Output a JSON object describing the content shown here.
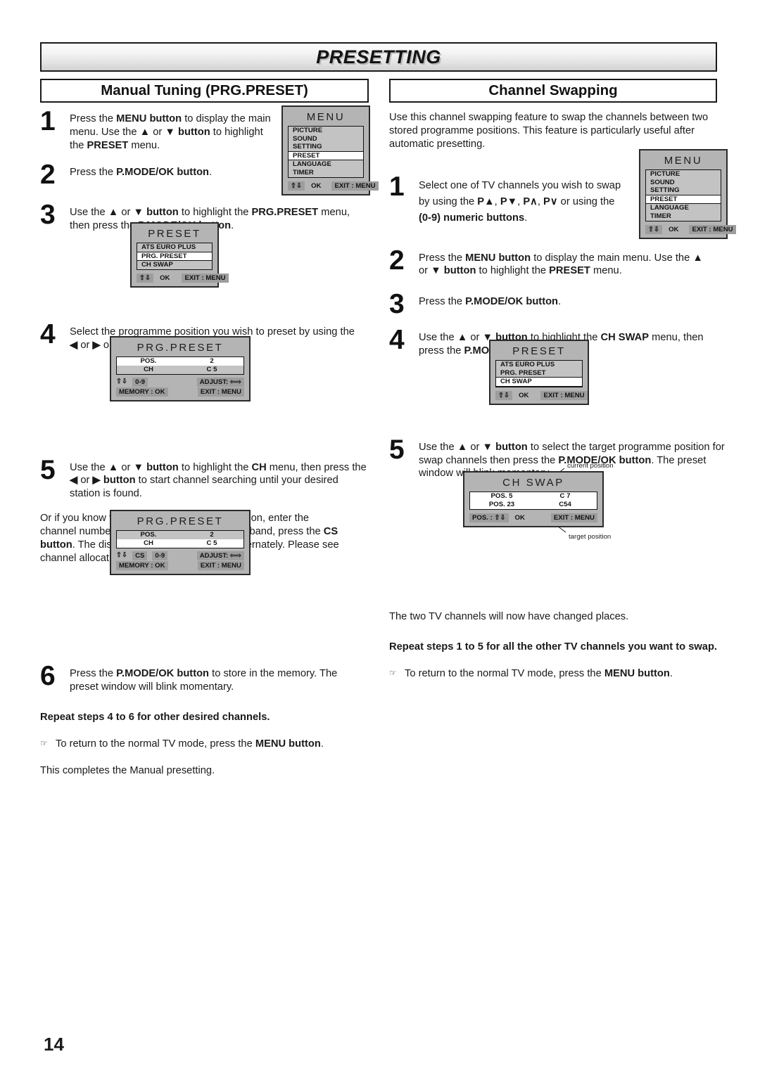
{
  "page": {
    "title": "PRESETTING",
    "number": "14"
  },
  "left": {
    "header": "Manual Tuning (PRG.PRESET)",
    "steps": {
      "s1": {
        "num": "1",
        "html": "Press the <b>MENU button</b> to display the main menu. Use the <b>&#9650;</b> or <b>&#9660; button</b> to highlight the <b>PRESET</b> menu."
      },
      "s2": {
        "num": "2",
        "html": "Press the <b>P.MODE/OK button</b>."
      },
      "s3": {
        "num": "3",
        "html": "Use the <b>&#9650;</b> or <b>&#9660; button</b> to highlight the <b>PRG.PRESET</b> menu, then press the <b>P.MODE/OK button</b>."
      },
      "s4": {
        "num": "4",
        "html": "Select the programme position you wish to preset by using the <b>&#9664;</b> or <b>&#9654;</b> or <b>0-9 numeric buttons</b>."
      },
      "s5": {
        "num": "5",
        "html": "Use the <b>&#9650;</b> or <b>&#9660; button</b> to highlight the <b>CH</b> menu, then press the <b>&#9664;</b> or <b>&#9654; button</b> to start channel searching until your desired station is found."
      },
      "s6": {
        "num": "6",
        "html": "Press the <b>P.MODE/OK button</b> to store in the memory.  The preset window will blink momentary."
      }
    },
    "paragraphs": {
      "band_note": "Or if you know the channel number of the station, enter the channel number directly. To switch to another band, press the <b>CS button</b>. The display changes &ldquo;C--&rdquo; to &ldquo;H--&rdquo; alternately. Please see channel allocation table on page 19.",
      "repeat": "Repeat steps 4 to 6 for other desired channels.",
      "return_note": "To return to the normal TV mode, press the <b>MENU button</b>.",
      "completes": "This completes the Manual presetting."
    }
  },
  "right": {
    "header": "Channel Swapping",
    "intro": "Use this channel swapping feature to swap the channels between two stored programme positions. This feature is particularly useful after automatic presetting.",
    "steps": {
      "s1": {
        "num": "1",
        "html": "Select one of TV channels you wish to swap by using the <b>P&#9650;</b>, <b>P&#9660;</b>, <b>P&#8743;</b>, <b>P&#8744;</b> or using the <b>(0-9) numeric buttons</b>."
      },
      "s2": {
        "num": "2",
        "html": "Press the <b>MENU button</b> to display the main menu. Use the <b>&#9650;</b> or <b>&#9660; button</b> to highlight the <b>PRESET</b> menu."
      },
      "s3": {
        "num": "3",
        "html": "Press the <b>P.MODE/OK button</b>."
      },
      "s4": {
        "num": "4",
        "html": "Use the <b>&#9650;</b> or <b>&#9660; button</b> to highlight the <b>CH SWAP</b> menu, then press the <b>P.MODE/OK button</b>."
      },
      "s5": {
        "num": "5",
        "html": "Use the <b>&#9650;</b> or <b>&#9660; button</b> to select the target programme position for swap channels then press the <b>P.MODE/OK button</b>. The preset window will blink momentary."
      }
    },
    "paragraphs": {
      "changed": "The two TV channels will now have changed places.",
      "repeat": "Repeat steps 1 to 5 for all the other TV channels you want to swap.",
      "return_note": "To return to the normal TV mode, press the <b>MENU button</b>."
    },
    "annotations": {
      "current_position": "current position",
      "target_position": "target position"
    }
  },
  "osd": {
    "menu_left": {
      "title": "MENU",
      "items": [
        "PICTURE",
        "SOUND",
        "SETTING",
        "PRESET",
        "LANGUAGE",
        "TIMER"
      ],
      "selected": "PRESET",
      "foot_ok": "OK",
      "foot_arrows": "⇧⇩",
      "foot_exit": "EXIT : MENU"
    },
    "menu_right": {
      "title": "MENU",
      "items": [
        "PICTURE",
        "SOUND",
        "SETTING",
        "PRESET",
        "LANGUAGE",
        "TIMER"
      ],
      "selected": "PRESET",
      "foot_ok": "OK",
      "foot_arrows": "⇧⇩",
      "foot_exit": "EXIT : MENU"
    },
    "preset_left": {
      "title": "PRESET",
      "items": [
        "ATS EURO PLUS",
        "PRG. PRESET",
        "CH SWAP"
      ],
      "selected": "PRG. PRESET",
      "foot_ok": "OK",
      "foot_arrows": "⇧⇩",
      "foot_exit": "EXIT : MENU"
    },
    "preset_right": {
      "title": "PRESET",
      "items": [
        "ATS EURO PLUS",
        "PRG. PRESET",
        "CH SWAP"
      ],
      "selected": "CH SWAP",
      "foot_ok": "OK",
      "foot_arrows": "⇧⇩",
      "foot_exit": "EXIT : MENU"
    },
    "prg_preset_1": {
      "title": "PRG.PRESET",
      "rows": [
        {
          "label": "POS.",
          "value": "2",
          "highlight": "white"
        },
        {
          "label": "CH",
          "value": "C 5",
          "highlight": "gray"
        }
      ],
      "foot_left_line1": "0-9",
      "foot_left_arrows": "⇧⇩",
      "foot_left_line2": "MEMORY : OK",
      "foot_right_line1": "ADJUST: ⇦⇨",
      "foot_right_line2": "EXIT : MENU"
    },
    "prg_preset_2": {
      "title": "PRG.PRESET",
      "rows": [
        {
          "label": "POS.",
          "value": "2",
          "highlight": "gray"
        },
        {
          "label": "CH",
          "value": "C 5",
          "highlight": "white"
        }
      ],
      "foot_left_arrows": "⇧⇩",
      "foot_left_cs": "CS",
      "foot_left_line1": "0-9",
      "foot_left_line2": "MEMORY : OK",
      "foot_right_line1": "ADJUST: ⇦⇨",
      "foot_right_line2": "EXIT : MENU"
    },
    "ch_swap": {
      "title": "CH  SWAP",
      "rows": [
        {
          "label": "POS. 5",
          "value": "C 7"
        },
        {
          "label": "POS. 23",
          "value": "C54"
        }
      ],
      "foot_pos": "POS. : ⇧⇩",
      "foot_ok": "OK",
      "foot_exit": "EXIT : MENU"
    }
  },
  "colors": {
    "osd_background": "#b4b4b4",
    "osd_list": "#c3c3c3",
    "osd_selected": "#ffffff",
    "chip": "#9d9d9d",
    "ink": "#1a1a1a"
  }
}
